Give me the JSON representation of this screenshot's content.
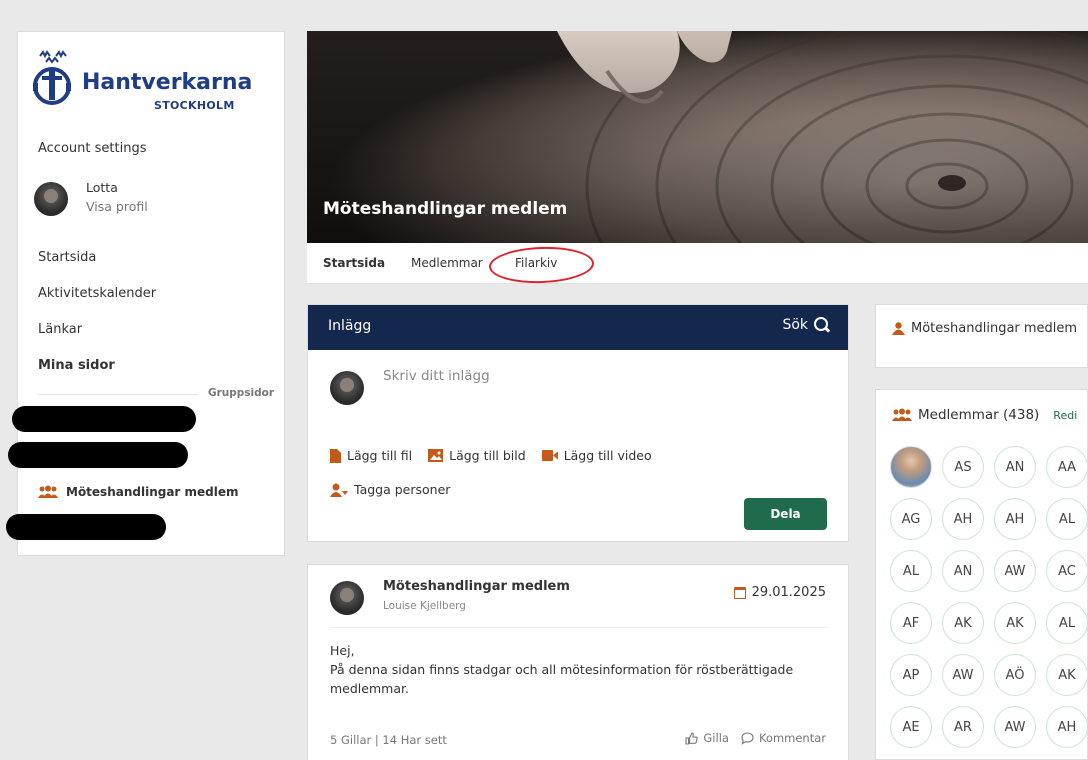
{
  "logo": {
    "word": "Hantverkarna",
    "sub": "STOCKHOLM"
  },
  "sidebar": {
    "account_settings": "Account settings",
    "profile": {
      "name": "Lotta",
      "link": "Visa profil"
    },
    "nav": [
      "Startsida",
      "Aktivitetskalender",
      "Länkar"
    ],
    "my_pages": "Mina sidor",
    "group_pages_label": "Gruppsidor",
    "group_item": "Möteshandlingar medlem"
  },
  "hero": {
    "title": "Möteshandlingar medlem"
  },
  "tabs": [
    "Startsida",
    "Medlemmar",
    "Filarkiv"
  ],
  "posts": {
    "header": "Inlägg",
    "search": "Sök",
    "write_placeholder": "Skriv ditt inlägg",
    "actions": {
      "file": "Lägg till fil",
      "image": "Lägg till bild",
      "video": "Lägg till video",
      "tag": "Tagga personer"
    },
    "share_button": "Dela"
  },
  "post": {
    "title": "Möteshandlingar medlem",
    "author": "Louise Kjellberg",
    "date": "29.01.2025",
    "greeting": "Hej,",
    "body": "På denna sidan finns stadgar och all mötesinformation för röstberättigade medlemmar.",
    "stats": "5 Gillar | 14 Har sett",
    "like": "Gilla",
    "comment": "Kommentar"
  },
  "right": {
    "group_name": "Möteshandlingar medlem",
    "members_label": "Medlemmar (438)",
    "edit": "Redi",
    "member_initials": [
      "AS",
      "AN",
      "AA",
      "AG",
      "AH",
      "AH",
      "AL",
      "AL",
      "AN",
      "AW",
      "AC",
      "AF",
      "AK",
      "AK",
      "AL",
      "AP",
      "AW",
      "AÖ",
      "AK",
      "AE",
      "AR",
      "AW",
      "AH"
    ]
  },
  "colors": {
    "accent_orange": "#c45a1a",
    "header_navy": "#14284d",
    "button_green": "#1f6b4b",
    "annotation_red": "#e0232b"
  }
}
